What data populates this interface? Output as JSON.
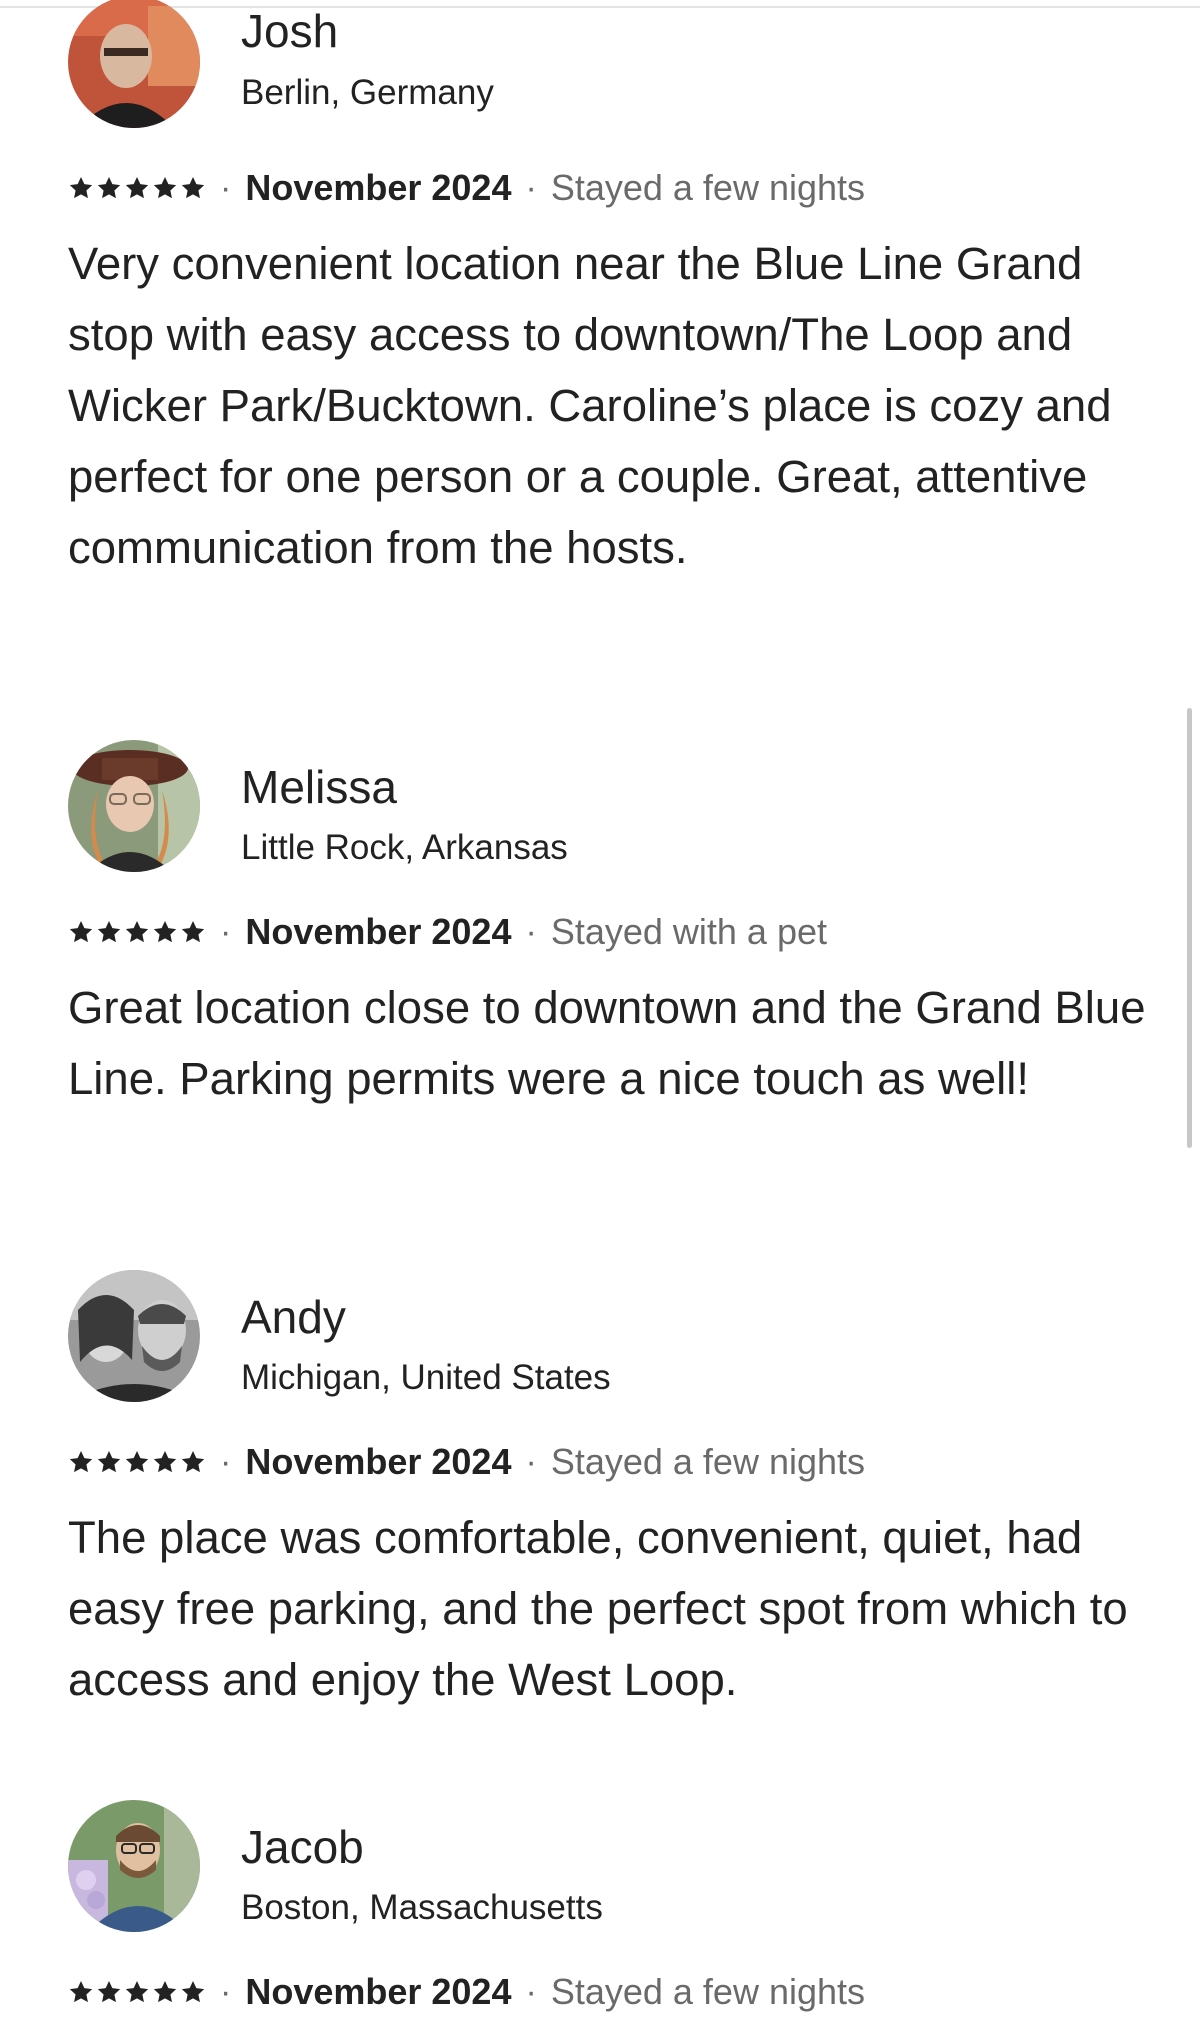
{
  "reviews": [
    {
      "name": "Josh",
      "location": "Berlin, Germany",
      "rating": 5,
      "separator": "·",
      "date": "November 2024",
      "stay": "Stayed a few nights",
      "text": "Very convenient location near the Blue Line Grand stop with easy access to downtown/The Loop and Wicker Park/Bucktown. Caroline’s place is cozy and perfect for one person or a couple. Great, attentive communication from the hosts."
    },
    {
      "name": "Melissa",
      "location": "Little Rock, Arkansas",
      "rating": 5,
      "separator": "·",
      "date": "November 2024",
      "stay": "Stayed with a pet",
      "text": "Great location close to downtown and the Grand Blue Line. Parking permits were a nice touch as well!"
    },
    {
      "name": "Andy",
      "location": "Michigan, United States",
      "rating": 5,
      "separator": "·",
      "date": "November 2024",
      "stay": "Stayed a few nights",
      "text": "The place was comfortable, convenient, quiet, had easy free parking, and the perfect spot from which to access and enjoy the West Loop."
    },
    {
      "name": "Jacob",
      "location": "Boston, Massachusetts",
      "rating": 5,
      "separator": "·",
      "date": "November 2024",
      "stay": "Stayed a few nights",
      "text": ""
    }
  ],
  "colors": {
    "text": "#222222",
    "muted": "#6a6a6a",
    "star": "#222222"
  },
  "icons": {
    "rating": "star-icon",
    "avatar": "user-photo"
  }
}
